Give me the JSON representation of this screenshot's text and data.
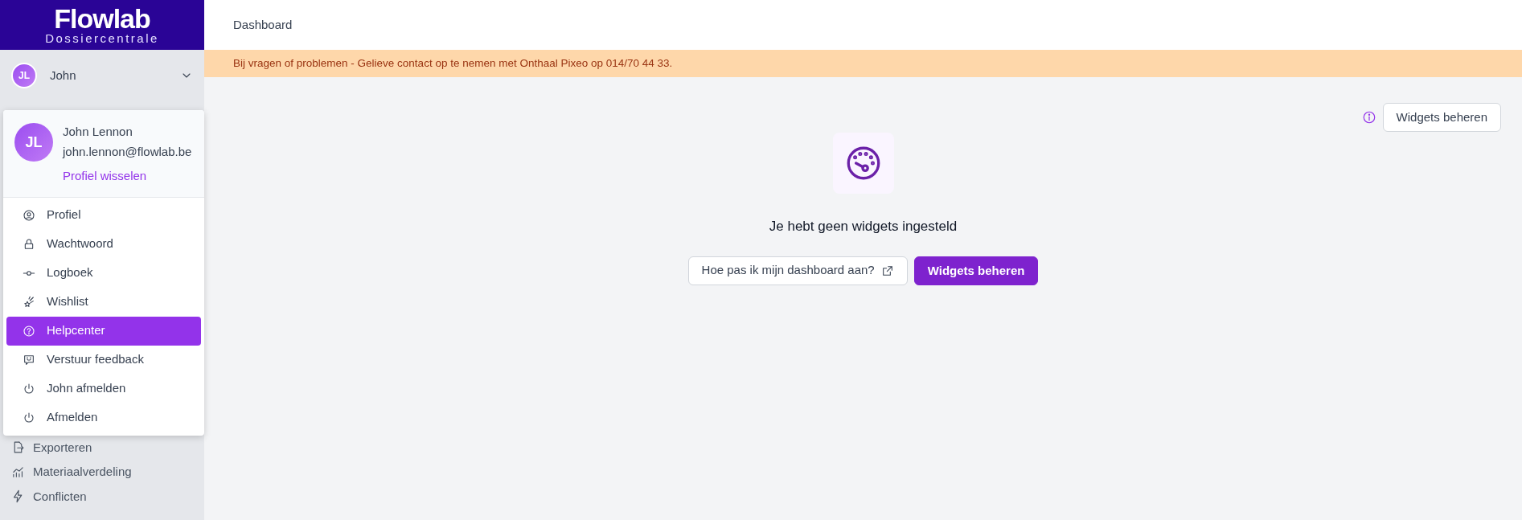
{
  "sidebar": {
    "logo": {
      "title": "Flowlab",
      "subtitle": "Dossiercentrale"
    },
    "user": {
      "initials": "JL",
      "name": "John",
      "expanded": true
    },
    "items": [
      {
        "label": "Exporteren",
        "selected": false
      },
      {
        "label": "Materiaalverdeling",
        "selected": false
      },
      {
        "label": "Conflicten",
        "selected": false
      }
    ]
  },
  "user_menu": {
    "initials": "JL",
    "full_name": "John Lennon",
    "email": "john.lennon@flowlab.be",
    "switch_link": "Profiel wisselen",
    "items": [
      {
        "label": "Profiel",
        "selected": false
      },
      {
        "label": "Wachtwoord",
        "selected": false
      },
      {
        "label": "Logboek",
        "selected": false
      },
      {
        "label": "Wishlist",
        "selected": false
      },
      {
        "label": "Helpcenter",
        "selected": true
      },
      {
        "label": "Verstuur feedback",
        "selected": false
      },
      {
        "label": "John afmelden",
        "selected": false
      },
      {
        "label": "Afmelden",
        "selected": false
      }
    ]
  },
  "header": {
    "title": "Dashboard"
  },
  "notice": "Bij vragen of problemen - Gelieve contact op te nemen met Onthaal Pixeo op 014/70 44 33.",
  "toolbar": {
    "button": "Widgets beheren"
  },
  "empty_state": {
    "message": "Je hebt geen widgets ingesteld",
    "help_button": "Hoe pas ik mijn dashboard aan?",
    "primary_button": "Widgets beheren"
  }
}
